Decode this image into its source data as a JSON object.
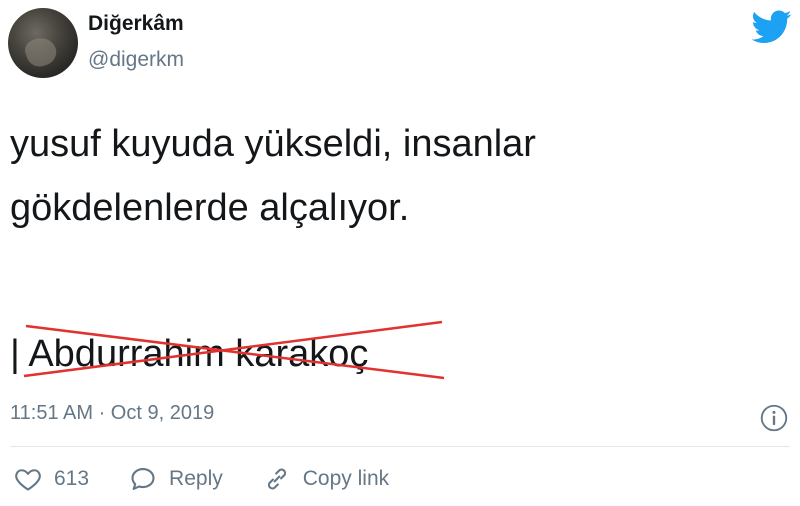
{
  "author": {
    "display_name": "Diğerkâm",
    "handle": "@digerkm"
  },
  "tweet": {
    "line1": "yusuf kuyuda yükseldi, insanlar",
    "line2": "gökdelenlerde alçalıyor.",
    "signature": "| Abdurrahim karakoç",
    "timestamp": "11:51 AM · Oct 9, 2019"
  },
  "actions": {
    "like_count": "613",
    "reply_label": "Reply",
    "copy_link_label": "Copy link"
  },
  "icons": {
    "brand": "twitter-bird-icon",
    "info": "info-icon",
    "like": "heart-icon",
    "reply": "reply-bubble-icon",
    "copy": "link-icon"
  },
  "colors": {
    "brand_blue": "#1da1f2",
    "secondary_text": "#657786",
    "strike_red": "#e0322f"
  }
}
